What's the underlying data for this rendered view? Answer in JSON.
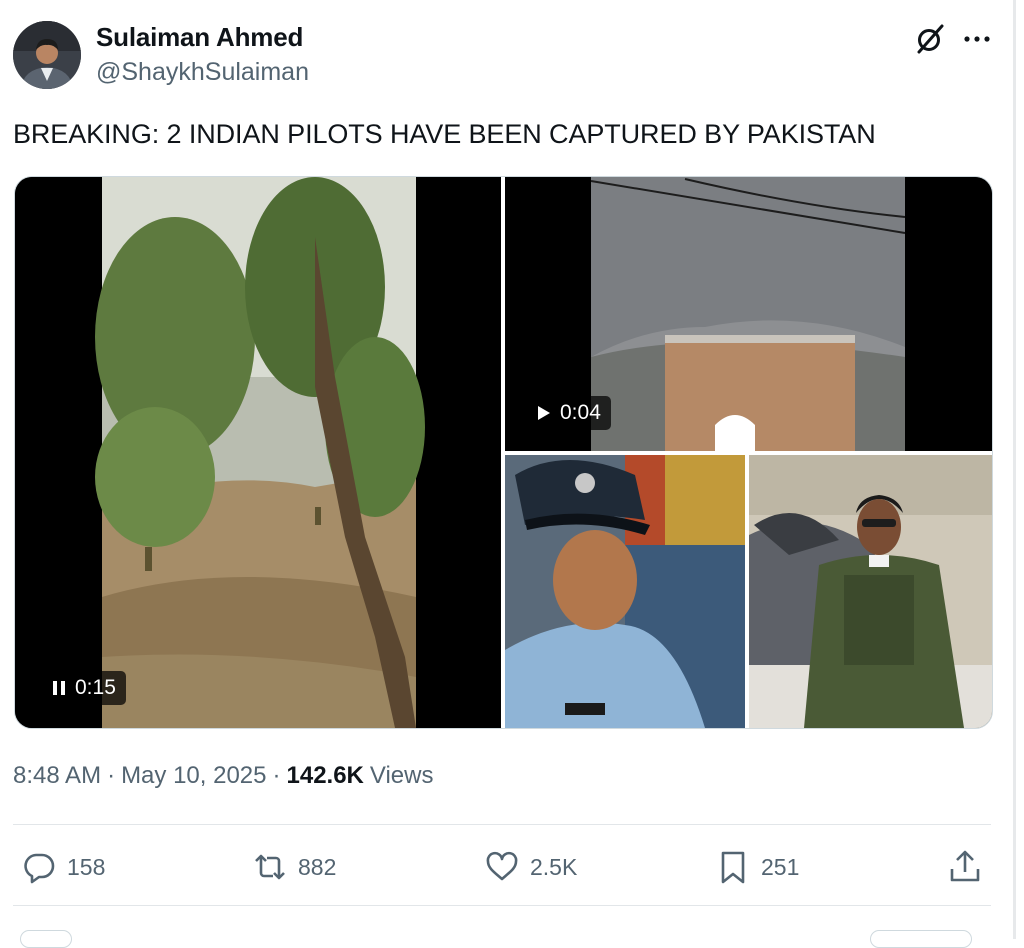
{
  "author": {
    "name": "Sulaiman Ahmed",
    "handle": "@ShaykhSulaiman",
    "avatar_icon": "avatar-photo"
  },
  "header_icons": {
    "grok": "grok-icon",
    "more": "more-icon"
  },
  "tweet": {
    "text": "BREAKING: 2 INDIAN PILOTS HAVE BEEN CAPTURED BY PAKISTAN"
  },
  "media": {
    "video1": {
      "state_icon": "pause-icon",
      "time": "0:15"
    },
    "video2": {
      "state_icon": "play-icon",
      "time": "0:04"
    }
  },
  "meta": {
    "time": "8:48 AM",
    "separator": "·",
    "date": "May 10, 2025",
    "views_count": "142.6K",
    "views_label": "Views"
  },
  "actions": {
    "reply": {
      "icon": "reply-icon",
      "count": "158"
    },
    "repost": {
      "icon": "repost-icon",
      "count": "882"
    },
    "like": {
      "icon": "like-icon",
      "count": "2.5K"
    },
    "bookmark": {
      "icon": "bookmark-icon",
      "count": "251"
    },
    "share": {
      "icon": "share-icon"
    }
  },
  "colors": {
    "text": "#0f1419",
    "muted": "#536471",
    "border": "#cfd9de"
  }
}
